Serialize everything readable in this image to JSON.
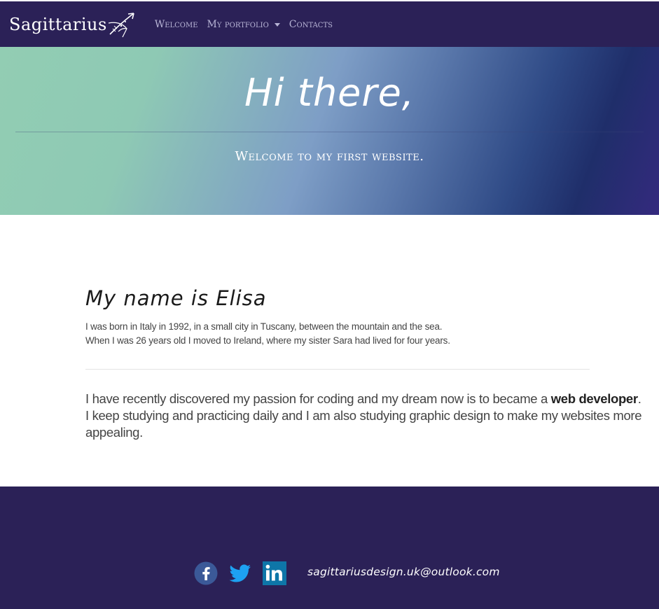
{
  "nav": {
    "brand": "Sagittarius",
    "links": [
      {
        "label": "Welcome"
      },
      {
        "label": "My portfolio"
      },
      {
        "label": "Contacts"
      }
    ]
  },
  "hero": {
    "title": "Hi there,",
    "subtitle": "Welcome to my first website."
  },
  "about": {
    "heading": "My name is Elisa",
    "line1": "I was born in Italy in 1992, in a small city in Tuscany, between the mountain and the sea.",
    "line2": "When I was 26 years old I moved to Ireland, where my sister Sara had lived for four years.",
    "passion_before": "I have recently discovered my passion for coding and my dream now is to became a ",
    "passion_bold": "web developer",
    "passion_after": ".",
    "line4": "I keep studying and practicing daily and I am also studying graphic design to make my websites more appealing."
  },
  "footer": {
    "social": [
      {
        "icon": "facebook-icon",
        "color": "#3b5998"
      },
      {
        "icon": "twitter-icon",
        "color": "#1da1f2"
      },
      {
        "icon": "linkedin-icon",
        "color": "#0e76a8"
      }
    ],
    "email": "sagittariusdesign.uk@outlook.com"
  },
  "colors": {
    "nav_bg": "#2b2157",
    "nav_link": "#b8b5d6",
    "footer_bg": "#2b2157"
  }
}
